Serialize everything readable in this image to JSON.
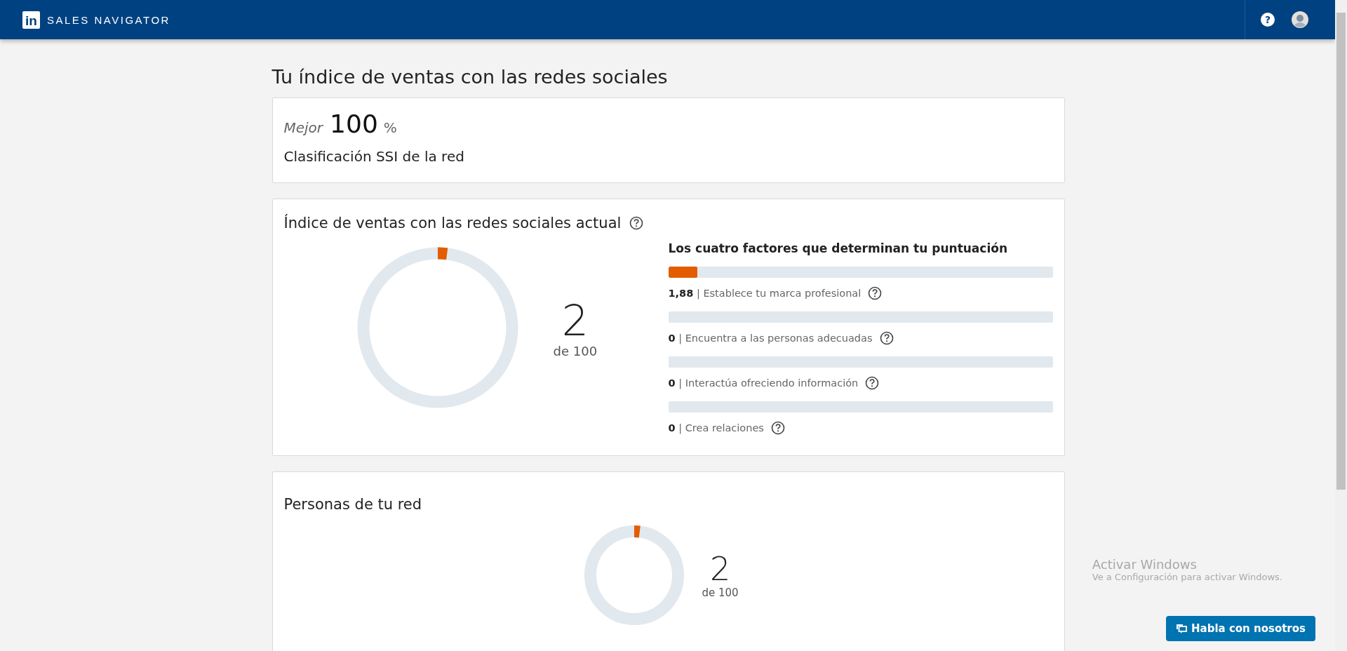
{
  "header": {
    "logo": "in",
    "product": "SALES NAVIGATOR",
    "help": "?"
  },
  "page_title": "Tu índice de ventas con las redes sociales",
  "rank_card": {
    "prefix": "Mejor",
    "value": "100",
    "unit": "%",
    "label": "Clasificación SSI de la red"
  },
  "current_card": {
    "title": "Índice de ventas con las redes sociales actual",
    "score": {
      "value": "2",
      "of": "de 100",
      "level": 0.02
    },
    "factors_title": "Los cuatro factores que determinan tu puntuación",
    "factors": [
      {
        "value": "1,88",
        "separator": "|",
        "label": "Establece tu marca profesional",
        "level": 0.075
      },
      {
        "value": "0",
        "separator": "|",
        "label": "Encuentra a las personas adecuadas",
        "level": 0
      },
      {
        "value": "0",
        "separator": "|",
        "label": "Interactúa ofreciendo información",
        "level": 0
      },
      {
        "value": "0",
        "separator": "|",
        "label": "Crea relaciones",
        "level": 0
      }
    ]
  },
  "network_card": {
    "title": "Personas de tu red",
    "score": {
      "value": "2",
      "of": "de 100",
      "level": 0.02
    }
  },
  "os_notice": {
    "title": "Activar Windows",
    "text": "Ve a Configuración para activar Windows."
  },
  "chat_button": "Habla con nosotros"
}
